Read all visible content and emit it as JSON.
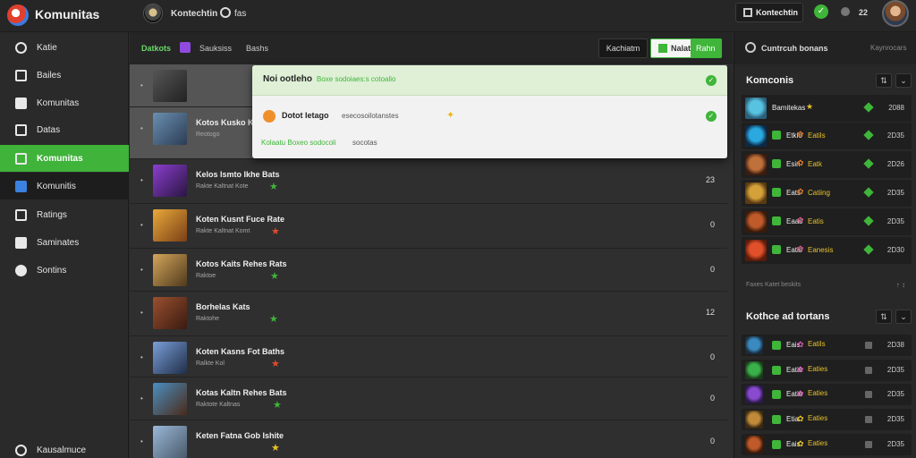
{
  "app": {
    "title": "Komunitas"
  },
  "topbar": {
    "user": "Kontechtin",
    "gear_label": "fas",
    "button_label": "Kontechtin",
    "status_glyph": "✓",
    "count": "22",
    "icons": [
      "app-logo-icon",
      "gear-icon",
      "bell-icon",
      "check-icon"
    ]
  },
  "sidebar": {
    "items": [
      {
        "label": "Katie",
        "icon": "home-icon"
      },
      {
        "label": "Bailes",
        "icon": "grid-icon"
      },
      {
        "label": "Komunitas",
        "icon": "house-icon"
      },
      {
        "label": "Datas",
        "icon": "text-icon"
      },
      {
        "label": "Komunitas",
        "icon": "community-icon",
        "active": true
      },
      {
        "label": "Komunitis",
        "icon": "chat-icon"
      },
      {
        "label": "Ratings",
        "icon": "chart-icon"
      },
      {
        "label": "Saminates",
        "icon": "calendar-icon"
      },
      {
        "label": "Sontins",
        "icon": "settings-icon"
      }
    ],
    "footer": "Kausalmuce"
  },
  "toolbar": {
    "tabs": [
      "Datkots",
      "Sauksiss",
      "Bashs"
    ],
    "button": "Kachiatm",
    "green_button": "Nalat",
    "green_button_2": "Rahn"
  },
  "popup": {
    "head_title": "Noi ootleho",
    "head_sub": "Boxe sodoiaes:s cotoalio",
    "body_title": "Dotot Ietago",
    "body_sub": "esecosoilotanstes",
    "body_spark": "✦",
    "foot": "Kolaatu Boxeo sodocoli",
    "foot2": "socotas"
  },
  "rows": [
    {
      "title": "",
      "sub": "",
      "count": "",
      "thumb": [
        "#555",
        "#222"
      ],
      "star": ""
    },
    {
      "title": "Kotos Kusko Kal",
      "sub": "Reotogo",
      "count": "",
      "thumb": [
        "#6a8fb0",
        "#2c3c55"
      ],
      "star": ""
    },
    {
      "title": "Kelos Ismto Ikhe Bats",
      "sub": "Rakte Kaltnat Kote",
      "count": "23",
      "thumb": [
        "#8a3ecf",
        "#2b1642"
      ],
      "star": "★",
      "star_color": "#3fb53a"
    },
    {
      "title": "Koten Kusnt Fuce Rate",
      "sub": "Rakte Kaltnat Komt",
      "count": "0",
      "thumb": [
        "#e8a93a",
        "#7a3f16"
      ],
      "star": "★",
      "star_color": "#e04a30"
    },
    {
      "title": "Kotos Kaits Rehes Rats",
      "sub": "Raktoe",
      "count": "0",
      "thumb": [
        "#d4a55b",
        "#4f3a1c"
      ],
      "star": "★",
      "star_color": "#3fb53a"
    },
    {
      "title": "Borhelas Kats",
      "sub": "Raktohe",
      "count": "12",
      "thumb": [
        "#9a5030",
        "#3a1a10"
      ],
      "star": "★",
      "star_color": "#3fb53a"
    },
    {
      "title": "Koten Kasns Fot Baths",
      "sub": "Ralkte Kol",
      "count": "0",
      "thumb": [
        "#7a9ed8",
        "#1f2e48"
      ],
      "star": "★",
      "star_color": "#e04a30"
    },
    {
      "title": "Kotas Kaltn Rehes Bats",
      "sub": "Raktote Kaltnas",
      "count": "0",
      "thumb": [
        "#4a8fc0",
        "#4a2a1a"
      ],
      "star": "★",
      "star_color": "#3fb53a"
    },
    {
      "title": "Keten Fatna Gob Ishite",
      "sub": "",
      "count": "0",
      "thumb": [
        "#9ab8d8",
        "#4a5a6a"
      ],
      "star": "★",
      "star_color": "#e6c22a"
    }
  ],
  "rpanel": {
    "head_title": "Cuntrcuh bonans",
    "head_right": "Kaynrocars",
    "section1": "Komconis",
    "section2": "Kothce ad tortans",
    "more": "Faxes Katet beskits",
    "more_ctrl": "↑ ↕",
    "list1": [
      {
        "name": "Bamitekas",
        "mid": "★",
        "mid_color": "#e6c22a",
        "mid_txt": "",
        "num": "2088",
        "av": [
          "#58c3e0",
          "#2a5f7a"
        ]
      },
      {
        "name": "Etkic",
        "mid": "✿",
        "mid_color": "#e07a2a",
        "mid_txt": "Eatils",
        "num": "2D35",
        "av": [
          "#2aa8e0",
          "#0a2a48"
        ]
      },
      {
        "name": "Esin",
        "mid": "✿",
        "mid_color": "#e07a2a",
        "mid_txt": "Eatk",
        "num": "2D26",
        "av": [
          "#c0703a",
          "#3a1c10"
        ]
      },
      {
        "name": "Eats",
        "mid": "✿",
        "mid_color": "#e07a2a",
        "mid_txt": "Catiing",
        "num": "2D35",
        "av": [
          "#d4a03a",
          "#5a3a10"
        ]
      },
      {
        "name": "Eaas",
        "mid": "✿",
        "mid_color": "#d45a8a",
        "mid_txt": "Eatis",
        "num": "2D35",
        "av": [
          "#c05a2a",
          "#3a1a0a"
        ]
      },
      {
        "name": "Eatls",
        "mid": "✿",
        "mid_color": "#d45a8a",
        "mid_txt": "Eanesis",
        "num": "2D30",
        "av": [
          "#e0502a",
          "#5a1a0a"
        ]
      }
    ],
    "list2": [
      {
        "name": "Eais",
        "mid_txt": "Eatils",
        "num": "2D38",
        "av": [
          "#3a8ac0",
          "#1a2a3a"
        ]
      },
      {
        "name": "Eatis",
        "mid_txt": "Eaties",
        "num": "2D35",
        "av": [
          "#3ab04a",
          "#1a3a1a"
        ]
      },
      {
        "name": "Eatie",
        "mid_txt": "Eaties",
        "num": "2D35",
        "av": [
          "#8a4ad0",
          "#2a1a48"
        ]
      },
      {
        "name": "Etia",
        "mid_txt": "Eaties",
        "num": "2D35",
        "av": [
          "#c08a3a",
          "#3a2a10"
        ]
      },
      {
        "name": "Eais",
        "mid_txt": "Eaties",
        "num": "2D35",
        "av": [
          "#c05a2a",
          "#3a1a0a"
        ]
      }
    ]
  },
  "colors": {
    "accent": "#3fb53a",
    "popup_bg": "#f2f2f2",
    "panel_bg": "#282828"
  }
}
